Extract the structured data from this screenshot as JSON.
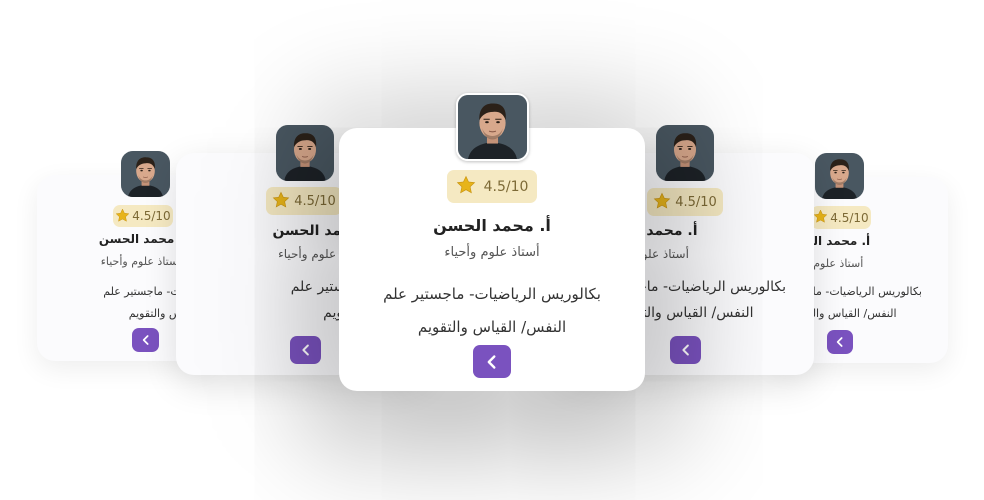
{
  "colors": {
    "accent": "#7a52bf",
    "rating_bg": "#f5e9c2",
    "star": "#e7b41a"
  },
  "cards": [
    {
      "rating": "4.5/10",
      "name": "أ. محمد الحسن",
      "role": "أستاذ علوم وأحياء",
      "bio_line1": "بكالوريس الرياضيات- ماجستير علم",
      "bio_line2": "النفس/ القياس والتقويم",
      "button_icon": "chevron-left-icon",
      "avatar_icon": "teacher-avatar"
    },
    {
      "rating": "4.5/10",
      "name": "أ. محمد الحسن",
      "role": "أستاذ علوم وأحياء",
      "bio_line1": "بكالوريس الرياضيات- ماجستير علم",
      "bio_line2": "النفس/ القياس والتقويم",
      "button_icon": "chevron-left-icon",
      "avatar_icon": "teacher-avatar"
    },
    {
      "rating": "4.5/10",
      "name": "أ. محمد الحسن",
      "role": "أستاذ علوم وأحياء",
      "bio_line1": "بكالوريس الرياضيات- ماجستير علم",
      "bio_line2": "النفس/ القياس والتقويم",
      "button_icon": "chevron-left-icon",
      "avatar_icon": "teacher-avatar"
    },
    {
      "rating": "4.5/10",
      "name": "أ. محمد الحسن",
      "role": "أستاذ علوم وأحياء",
      "bio_line1": "بكالوريس الرياضيات- ماجستير علم",
      "bio_line2": "النفس/ القياس والتقويم",
      "button_icon": "chevron-left-icon",
      "avatar_icon": "teacher-avatar"
    },
    {
      "rating": "4.5/10",
      "name": "أ. محمد الحسن",
      "role": "أستاذ علوم وأحياء",
      "bio_line1": "بكالوريس الرياضيات- ماجستير علم",
      "bio_line2": "النفس/ القياس والتقويم",
      "button_icon": "chevron-left-icon",
      "avatar_icon": "teacher-avatar"
    }
  ]
}
